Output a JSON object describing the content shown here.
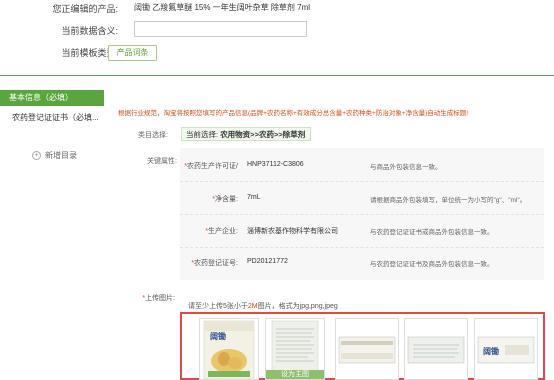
{
  "header": {
    "editing_label": "您正编辑的产品:",
    "editing_value": "阔锄 乙羧氟草醚 15% 一年生阔叶杂草 除草剂 7ml",
    "meaning_label": "当前数据含义:",
    "meaning_placeholder": "",
    "template_label": "当前模板类型:",
    "template_button": "产品词条"
  },
  "sidebar": {
    "active_item": "基本信息（必填）",
    "item_2": "农药登记证证书（必填...",
    "add_label": "新增目录"
  },
  "main": {
    "notice": "根据行业规范，淘宝将按照您填写的产品信息(品牌+农药名称+有效成分总含量+农药种类+防治对象+净含量)自动生成标题!",
    "category_label": "类目选择:",
    "category_prefix": "当前选择:",
    "category_path": "农用物资>>农药>>除草剂",
    "key_attrs_label": "关键属性:",
    "attributes": [
      {
        "label": "农药生产许可证/",
        "value": "HNP37112-C3806",
        "hint": "与商品外包装信息一致。"
      },
      {
        "label": "净含量:",
        "value": "7mL",
        "hint": "请根据商品外包装填写，单位统一为小写的\"g\"、\"ml\"。"
      },
      {
        "label": "生产企业:",
        "value": "淄博新农基作物科学有限公司",
        "hint": "与农药登记证证书或商品外包装信息一致。"
      },
      {
        "label": "农药登记证号:",
        "value": "PD20121772",
        "hint": "与农药登记证证书及商品外包装信息一致。"
      }
    ],
    "upload_label": "上传图片:",
    "upload_hint_prefix": "请至少上传5张小于",
    "upload_hint_size": "2M",
    "upload_hint_suffix": "图片，格式为jpg,png,jpeg",
    "thumb_brand": "阔锄",
    "thumb_tag": "设为主图"
  },
  "colors": {
    "accent_green": "#5aa540",
    "notice_red": "#d84a1a",
    "upload_border": "#e0484a"
  }
}
